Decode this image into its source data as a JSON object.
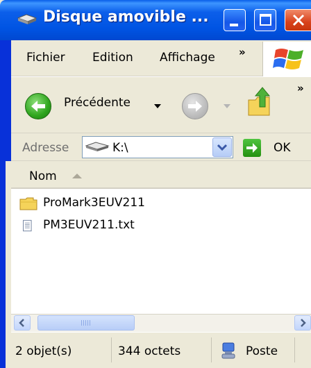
{
  "window": {
    "title": "Disque amovible ...",
    "title_icon": "drive-icon"
  },
  "menu": {
    "items": [
      "Fichier",
      "Edition",
      "Affichage"
    ],
    "overflow": "»"
  },
  "toolbar": {
    "back_label": "Précédente",
    "overflow": "»"
  },
  "address": {
    "label": "Adresse",
    "value": "K:\\",
    "go_label": "OK"
  },
  "filelist": {
    "column_header": "Nom",
    "items": [
      {
        "name": "ProMark3EUV211",
        "icon": "folder-icon"
      },
      {
        "name": "PM3EUV211.txt",
        "icon": "text-file-icon"
      }
    ]
  },
  "statusbar": {
    "count": "2 objet(s)",
    "size": "344 octets",
    "zone": "Poste"
  },
  "colors": {
    "title_bar": "#0054e3",
    "close_button": "#d8411b",
    "window_bg": "#ece9d8",
    "back_button": "#2fa51e"
  }
}
